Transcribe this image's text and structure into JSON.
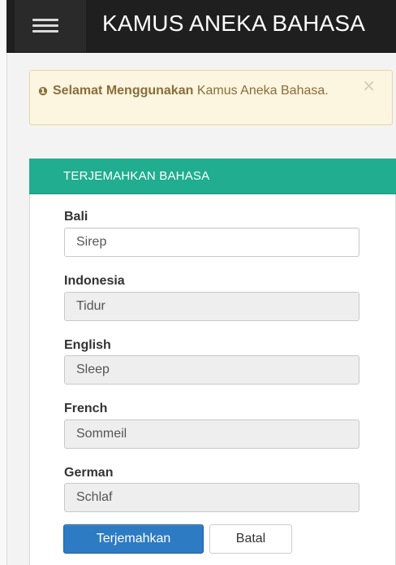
{
  "app": {
    "title": "KAMUS ANEKA BAHASA",
    "menu_icon": "hamburger-menu-icon"
  },
  "alert": {
    "icon": "exclamation-circle-icon",
    "strong_text": "Selamat Menggunakan",
    "text": " Kamus Aneka Bahasa.",
    "close_symbol": "×"
  },
  "panel": {
    "title": "TERJEMAHKAN BAHASA",
    "fields": [
      {
        "label": "Bali",
        "value": "Sirep",
        "editable": true
      },
      {
        "label": "Indonesia",
        "value": "Tidur",
        "editable": false
      },
      {
        "label": "English",
        "value": "Sleep",
        "editable": false
      },
      {
        "label": "French",
        "value": "Sommeil",
        "editable": false
      },
      {
        "label": "German",
        "value": "Schlaf",
        "editable": false
      }
    ],
    "buttons": {
      "translate": "Terjemahkan",
      "cancel": "Batal"
    }
  },
  "colors": {
    "topbar": "#1f1f1f",
    "panel_header": "#21ad8f",
    "primary_button": "#2d7bc3",
    "alert_background": "#fcf5df"
  }
}
